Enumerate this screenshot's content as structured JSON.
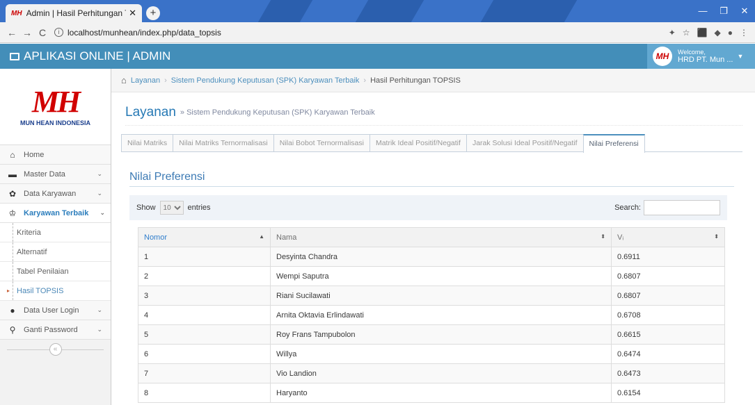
{
  "browser": {
    "tab_title": "Admin | Hasil Perhitungan TOPSIS",
    "tab_favicon": "MH",
    "url": "localhost/munhean/index.php/data_topsis",
    "new_tab": "+",
    "tab_close": "✕",
    "win_min": "—",
    "win_max": "❐",
    "win_close": "✕",
    "back": "←",
    "forward": "→",
    "reload": "C",
    "info_icon": "i",
    "ext_icons": [
      "✦",
      "☆",
      "⬛",
      "◆",
      "●",
      "⋮"
    ]
  },
  "topbar": {
    "app_title": "APLIKASI ONLINE | ADMIN",
    "avatar_text": "MH",
    "welcome": "Welcome,",
    "user_name": "HRD PT. Mun ...",
    "caret": "▼"
  },
  "logo": {
    "mark": "MH",
    "name": "MUN HEAN INDONESIA"
  },
  "sidebar": {
    "items": [
      {
        "icon": "⌂",
        "label": "Home"
      },
      {
        "icon": "▬",
        "label": "Master Data",
        "chev": "⌄"
      },
      {
        "icon": "✿",
        "label": "Data Karyawan",
        "chev": "⌄"
      },
      {
        "icon": "♔",
        "label": "Karyawan Terbaik",
        "chev": "⌄"
      }
    ],
    "sub": [
      "Kriteria",
      "Alternatif",
      "Tabel Penilaian",
      "Hasil TOPSIS"
    ],
    "sub_arrow": "▸",
    "items2": [
      {
        "icon": "●",
        "label": "Data User Login",
        "chev": "⌄"
      },
      {
        "icon": "⚲",
        "label": "Ganti Password",
        "chev": "⌄"
      }
    ],
    "collapse": "«"
  },
  "breadcrumb": {
    "home_icon": "⌂",
    "items": [
      "Layanan",
      "Sistem Pendukung Keputusan (SPK) Karyawan Terbaik",
      "Hasil Perhitungan TOPSIS"
    ],
    "sep": "›"
  },
  "page": {
    "title": "Layanan",
    "subtitle": "» Sistem Pendukung Keputusan (SPK) Karyawan Terbaik"
  },
  "tabs": [
    "Nilai Matriks",
    "Nilai Matriks Ternormalisasi",
    "Nilai Bobot Ternormalisasi",
    "Matrik Ideal Positif/Negatif",
    "Jarak Solusi Ideal Positif/Negatif",
    "Nilai Preferensi"
  ],
  "panel_title": "Nilai Preferensi",
  "datatable": {
    "show": "Show",
    "length": "10",
    "entries": "entries",
    "search_label": "Search:",
    "columns": [
      "Nomor",
      "Nama",
      "Vᵢ"
    ],
    "sort_asc": "▲",
    "sort_both": "⬍",
    "rows": [
      [
        "1",
        "Desyinta Chandra",
        "0.6911"
      ],
      [
        "2",
        "Wempi Saputra",
        "0.6807"
      ],
      [
        "3",
        "Riani Sucilawati",
        "0.6807"
      ],
      [
        "4",
        "Arnita Oktavia Erlindawati",
        "0.6708"
      ],
      [
        "5",
        "Roy Frans Tampubolon",
        "0.6615"
      ],
      [
        "6",
        "Willya",
        "0.6474"
      ],
      [
        "7",
        "Vio Landion",
        "0.6473"
      ],
      [
        "8",
        "Haryanto",
        "0.6154"
      ]
    ]
  }
}
